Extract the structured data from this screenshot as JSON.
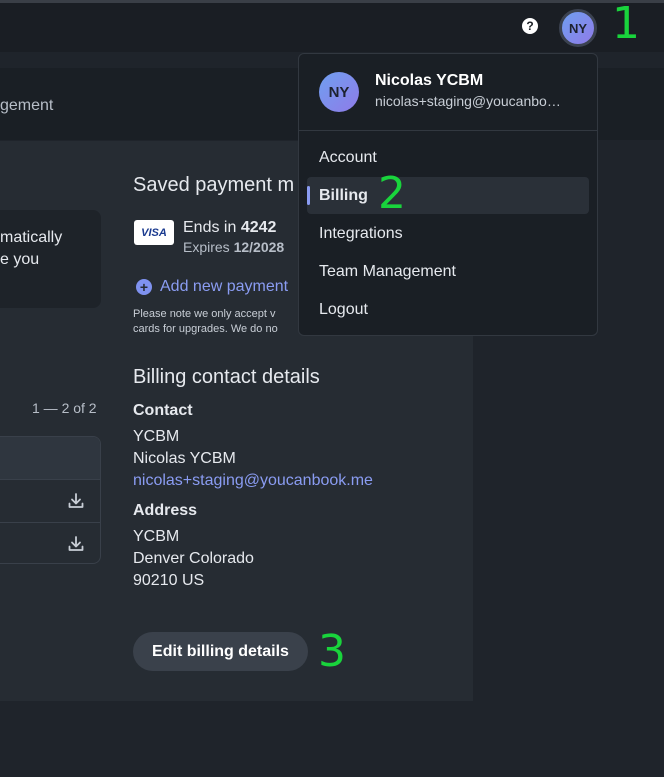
{
  "topbar": {
    "help_icon": "help-circle-icon",
    "avatar_initials": "NY"
  },
  "annotations": {
    "one": "1",
    "two": "2",
    "three": "3"
  },
  "nav": {
    "partial_tab": "gement"
  },
  "left": {
    "notice_line1": "matically",
    "notice_line2": "e you",
    "invoice_range": "1 — 2 of 2",
    "download_icon": "download-icon"
  },
  "payment": {
    "heading": "Saved payment m",
    "card_brand": "VISA",
    "ends_prefix": "Ends in ",
    "ends_digits": "4242",
    "expires_prefix": "Expires ",
    "expires_date": "12/2028",
    "add_label": "Add new payment",
    "note_line1": "Please note we only accept v",
    "note_line2": "cards for upgrades. We do no"
  },
  "billing_contact": {
    "heading": "Billing contact details",
    "contact_label": "Contact",
    "company": "YCBM",
    "name": "Nicolas YCBM",
    "email": "nicolas+staging@youcanbook.me",
    "address_label": "Address",
    "addr_company": "YCBM",
    "addr_city": "Denver Colorado",
    "addr_zip": "90210 US"
  },
  "edit_button": "Edit billing details",
  "user_menu": {
    "initials": "NY",
    "name": "Nicolas YCBM",
    "email": "nicolas+staging@youcanbo…",
    "items": [
      "Account",
      "Billing",
      "Integrations",
      "Team Management",
      "Logout"
    ],
    "active_item": "Billing"
  },
  "colors": {
    "accent": "#8a9cf2",
    "annotation": "#19d43c"
  }
}
